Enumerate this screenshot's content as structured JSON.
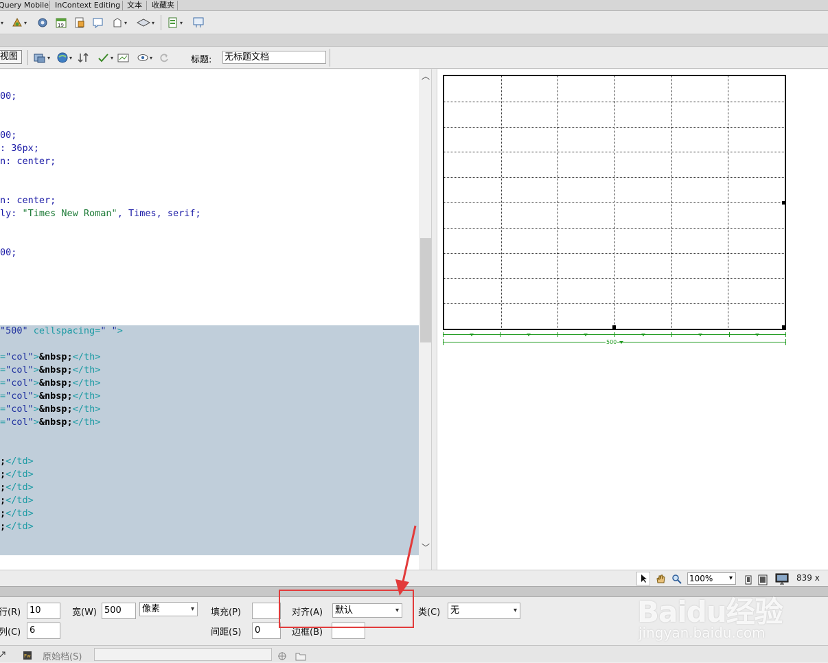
{
  "tabs": [
    "Query Mobile",
    "InContext Editing",
    "文本",
    "收藏夹"
  ],
  "doc_toolbar": {
    "view_button": "视图",
    "title_label": "标题:",
    "title_value": "无标题文档"
  },
  "code_lines": [
    {
      "parts": [
        {
          "t": "00;",
          "c": "cp"
        }
      ]
    },
    {
      "parts": [
        {
          "t": "00;",
          "c": "cp"
        }
      ]
    },
    {
      "parts": [
        {
          "t": ": 36px;",
          "c": "cp"
        }
      ]
    },
    {
      "parts": [
        {
          "t": "n: center;",
          "c": "cp"
        }
      ]
    },
    {
      "parts": [
        {
          "t": "n: center;",
          "c": "cp"
        }
      ]
    },
    {
      "parts": [
        {
          "t": "ly: ",
          "c": "cp"
        },
        {
          "t": "\"Times New Roman\"",
          "c": "cg"
        },
        {
          "t": ", Times, serif;",
          "c": "cp"
        }
      ]
    },
    {
      "parts": [
        {
          "t": "00;",
          "c": "cp"
        }
      ]
    },
    {
      "parts": [
        {
          "t": "\"500\"",
          "c": "cb"
        },
        {
          "t": " cellspacing=",
          "c": "ct"
        },
        {
          "t": "\" \"",
          "c": "cb"
        },
        {
          "t": ">",
          "c": "ct"
        }
      ]
    },
    {
      "parts": [
        {
          "t": "=",
          "c": "ct"
        },
        {
          "t": "\"col\"",
          "c": "cb"
        },
        {
          "t": ">",
          "c": "ct"
        },
        {
          "t": "&nbsp;",
          "c": "cbk"
        },
        {
          "t": "</th>",
          "c": "ct"
        }
      ]
    },
    {
      "parts": [
        {
          "t": "=",
          "c": "ct"
        },
        {
          "t": "\"col\"",
          "c": "cb"
        },
        {
          "t": ">",
          "c": "ct"
        },
        {
          "t": "&nbsp;",
          "c": "cbk"
        },
        {
          "t": "</th>",
          "c": "ct"
        }
      ]
    },
    {
      "parts": [
        {
          "t": "=",
          "c": "ct"
        },
        {
          "t": "\"col\"",
          "c": "cb"
        },
        {
          "t": ">",
          "c": "ct"
        },
        {
          "t": "&nbsp;",
          "c": "cbk"
        },
        {
          "t": "</th>",
          "c": "ct"
        }
      ]
    },
    {
      "parts": [
        {
          "t": "=",
          "c": "ct"
        },
        {
          "t": "\"col\"",
          "c": "cb"
        },
        {
          "t": ">",
          "c": "ct"
        },
        {
          "t": "&nbsp;",
          "c": "cbk"
        },
        {
          "t": "</th>",
          "c": "ct"
        }
      ]
    },
    {
      "parts": [
        {
          "t": "=",
          "c": "ct"
        },
        {
          "t": "\"col\"",
          "c": "cb"
        },
        {
          "t": ">",
          "c": "ct"
        },
        {
          "t": "&nbsp;",
          "c": "cbk"
        },
        {
          "t": "</th>",
          "c": "ct"
        }
      ]
    },
    {
      "parts": [
        {
          "t": "=",
          "c": "ct"
        },
        {
          "t": "\"col\"",
          "c": "cb"
        },
        {
          "t": ">",
          "c": "ct"
        },
        {
          "t": "&nbsp;",
          "c": "cbk"
        },
        {
          "t": "</th>",
          "c": "ct"
        }
      ]
    },
    {
      "parts": [
        {
          "t": ";",
          "c": "cbk"
        },
        {
          "t": "</td>",
          "c": "ct"
        }
      ]
    },
    {
      "parts": [
        {
          "t": ";",
          "c": "cbk"
        },
        {
          "t": "</td>",
          "c": "ct"
        }
      ]
    },
    {
      "parts": [
        {
          "t": ";",
          "c": "cbk"
        },
        {
          "t": "</td>",
          "c": "ct"
        }
      ]
    },
    {
      "parts": [
        {
          "t": ";",
          "c": "cbk"
        },
        {
          "t": "</td>",
          "c": "ct"
        }
      ]
    },
    {
      "parts": [
        {
          "t": ";",
          "c": "cbk"
        },
        {
          "t": "</td>",
          "c": "ct"
        }
      ]
    },
    {
      "parts": [
        {
          "t": ";",
          "c": "cbk"
        },
        {
          "t": "</td>",
          "c": "ct"
        }
      ]
    }
  ],
  "design_table": {
    "rows": 10,
    "cols": 6,
    "width_label": "500"
  },
  "statusbar": {
    "zoom": "100%",
    "window_size": "839 x"
  },
  "properties": {
    "rows_label": "行(R)",
    "rows_value": "10",
    "cols_label": "列(C)",
    "cols_value": "6",
    "width_label": "宽(W)",
    "width_value": "500",
    "unit_value": "像素",
    "padding_label": "填充(P)",
    "padding_value": "",
    "spacing_label": "间距(S)",
    "spacing_value": "0",
    "align_label": "对齐(A)",
    "align_value": "默认",
    "border_label": "边框(B)",
    "border_value": "",
    "class_label": "类(C)",
    "class_value": "无"
  },
  "resultsbar": {
    "source_label": "原始档(S)"
  },
  "watermark": {
    "logo": "Baidu经验",
    "url": "jingyan.baidu.com"
  },
  "colors": {
    "highlight": "#e23b3b",
    "selection": "#c0ceda",
    "width_marker": "#1e9a1e"
  }
}
